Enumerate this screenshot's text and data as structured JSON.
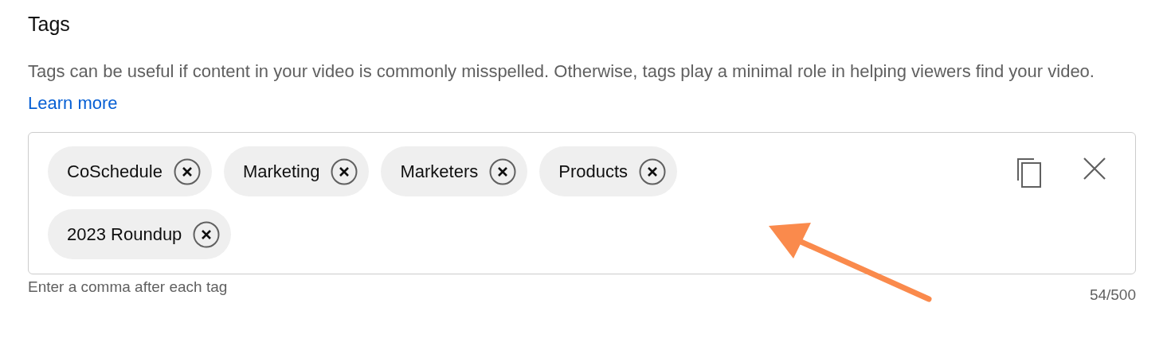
{
  "section": {
    "title": "Tags",
    "description": "Tags can be useful if content in your video is commonly misspelled. Otherwise, tags play a minimal role in helping viewers find your video.",
    "link": "Learn more"
  },
  "tags": [
    {
      "label": "CoSchedule"
    },
    {
      "label": "Marketing"
    },
    {
      "label": "Marketers"
    },
    {
      "label": "Products"
    },
    {
      "label": "2023 Roundup"
    }
  ],
  "hint": "Enter a comma after each tag",
  "counter": "54/500"
}
